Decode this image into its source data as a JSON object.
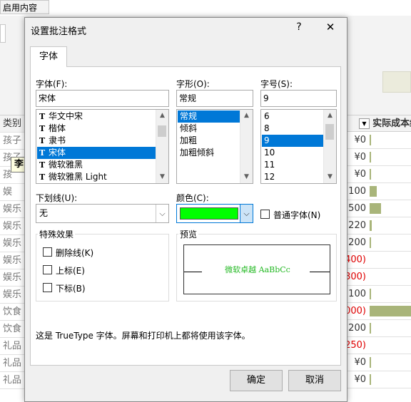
{
  "toolbar": {
    "enable_content_label": "启用内容"
  },
  "sheet": {
    "left_header": "类别",
    "left_cells": [
      "孩子",
      "孩子",
      "孩",
      "娱",
      "娱乐",
      "娱乐",
      "娱乐",
      "娱乐",
      "娱乐",
      "娱乐",
      "饮食",
      "饮食",
      "礼品",
      "礼品",
      "礼品"
    ],
    "comment_char": "李",
    "right_header": "实际成本结",
    "rows": [
      {
        "text": "¥0",
        "color": "#333333",
        "bar": 0.03
      },
      {
        "text": "¥0",
        "color": "#333333",
        "bar": 0.03
      },
      {
        "text": "¥0",
        "color": "#333333",
        "bar": 0.03
      },
      {
        "text": "100",
        "color": "#333333",
        "bar": 0.17
      },
      {
        "text": "500",
        "color": "#333333",
        "bar": 0.27
      },
      {
        "text": "220",
        "color": "#333333",
        "bar": 0.05
      },
      {
        "text": "200",
        "color": "#333333",
        "bar": 0.03
      },
      {
        "text": "400)",
        "color": "#e00000",
        "bar": 0
      },
      {
        "text": "300)",
        "color": "#e00000",
        "bar": 0
      },
      {
        "text": "100",
        "color": "#333333",
        "bar": 0.03
      },
      {
        "text": "000)",
        "color": "#e00000",
        "bar": 1.0
      },
      {
        "text": "200",
        "color": "#333333",
        "bar": 0.03
      },
      {
        "text": "250)",
        "color": "#e00000",
        "bar": 0
      },
      {
        "text": "¥0",
        "color": "#333333",
        "bar": 0.03
      },
      {
        "text": "¥0",
        "color": "#333333",
        "bar": 0.03
      }
    ]
  },
  "dialog": {
    "title": "设置批注格式",
    "help": "?",
    "close": "✕",
    "tab": "字体",
    "font_label": "字体(F):",
    "font_value": "宋体",
    "font_list": [
      "华文中宋",
      "楷体",
      "隶书",
      "宋体",
      "微软雅黑",
      "微软雅黑 Light"
    ],
    "font_selected_index": 3,
    "style_label": "字形(O):",
    "style_value": "常规",
    "style_list": [
      "常规",
      "倾斜",
      "加粗",
      "加粗倾斜"
    ],
    "style_selected_index": 0,
    "size_label": "字号(S):",
    "size_value": "9",
    "size_list": [
      "6",
      "8",
      "9",
      "10",
      "11",
      "12"
    ],
    "size_selected_index": 2,
    "underline_label": "下划线(U):",
    "underline_value": "无",
    "color_label": "颜色(C):",
    "color_value": "#00ff00",
    "normal_font_label": "普通字体(N)",
    "normal_font_checked": false,
    "effects_label": "特殊效果",
    "strike_label": "删除线(K)",
    "strike_checked": false,
    "super_label": "上标(E)",
    "super_checked": false,
    "sub_label": "下标(B)",
    "sub_checked": false,
    "preview_label": "预览",
    "preview_text": "微软卓越  AaBbCc",
    "info_text": "这是 TrueType 字体。屏幕和打印机上都将使用该字体。",
    "ok_label": "确定",
    "cancel_label": "取消"
  }
}
